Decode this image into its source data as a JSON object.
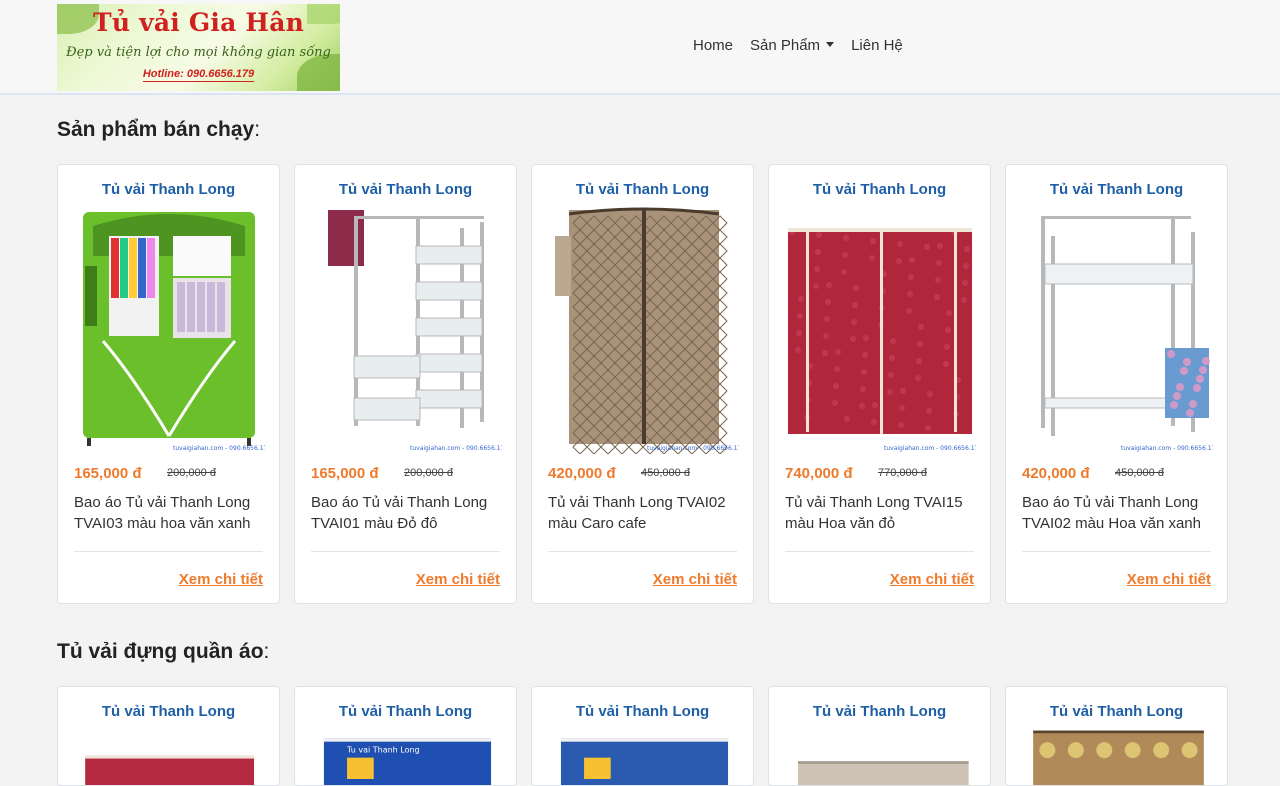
{
  "logo": {
    "title": "Tủ vải Gia Hân",
    "tagline": "Đẹp và tiện lợi cho mọi không gian sống",
    "hotline": "Hotline: 090.6656.179"
  },
  "nav": {
    "items": [
      "Home",
      "Sản Phẩm",
      "Liên Hệ"
    ]
  },
  "sections": [
    {
      "title": "Sản phẩm bán chạy",
      "colon": ":"
    },
    {
      "title": "Tủ vải đựng quần áo",
      "colon": ":"
    }
  ],
  "bestsellers": [
    {
      "brand": "Tủ vải Thanh Long",
      "price": "165,000 đ",
      "old_price": "200,000 đ",
      "name": "Bao áo Tủ vải Thanh Long TVAI03 màu hoa văn xanh",
      "more": "Xem chi tiết",
      "image": "green-fabric-wardrobe",
      "color": "#6bbf2a",
      "watermark": "tuvaigiahan.com - 090.6656.179"
    },
    {
      "brand": "Tủ vải Thanh Long",
      "price": "165,000 đ",
      "old_price": "200,000 đ",
      "name": "Bao áo Tủ vải Thanh Long TVAI01 màu Đỏ đô",
      "more": "Xem chi tiết",
      "image": "wardrobe-frame",
      "color": "#8e2a4a",
      "watermark": "tuvaigiahan.com - 090.6656.179"
    },
    {
      "brand": "Tủ vải Thanh Long",
      "price": "420,000 đ",
      "old_price": "450,000 đ",
      "name": "Tủ vải Thanh Long TVAI02 màu Caro cafe",
      "more": "Xem chi tiết",
      "image": "caro-wardrobe",
      "color": "#a8937a",
      "watermark": "tuvaigiahan.com - 090.6656.179"
    },
    {
      "brand": "Tủ vải Thanh Long",
      "price": "740,000 đ",
      "old_price": "770,000 đ",
      "name": "Tủ vải Thanh Long TVAI15 màu Hoa văn đỏ",
      "more": "Xem chi tiết",
      "image": "red-wardrobe",
      "color": "#b0263a",
      "watermark": "tuvaigiahan.com - 090.6656.179"
    },
    {
      "brand": "Tủ vải Thanh Long",
      "price": "420,000 đ",
      "old_price": "450,000 đ",
      "name": "Bao áo Tủ vải Thanh Long TVAI02 màu Hoa văn xanh",
      "more": "Xem chi tiết",
      "image": "frame-with-cover",
      "color": "#6a9bd0",
      "watermark": "tuvaigiahan.com - 090.6656.179"
    }
  ],
  "wardrobes": [
    {
      "brand": "Tủ vải Thanh Long",
      "image": "red-wardrobe",
      "color": "#b52a40"
    },
    {
      "brand": "Tủ vải Thanh Long",
      "image": "blue-wardrobe",
      "color": "#1f4fb0",
      "label": "Tu vai Thanh Long"
    },
    {
      "brand": "Tủ vải Thanh Long",
      "image": "blue-wardrobe",
      "color": "#2a5bb0"
    },
    {
      "brand": "Tủ vải Thanh Long",
      "image": "beige-wardrobe",
      "color": "#cfc3b6"
    },
    {
      "brand": "Tủ vải Thanh Long",
      "image": "patterned-wardrobe",
      "color": "#b08a58"
    }
  ],
  "colors": {
    "brand_blue": "#1f5fa6",
    "price_orange": "#ef7a2c",
    "logo_red": "#d0211f"
  }
}
